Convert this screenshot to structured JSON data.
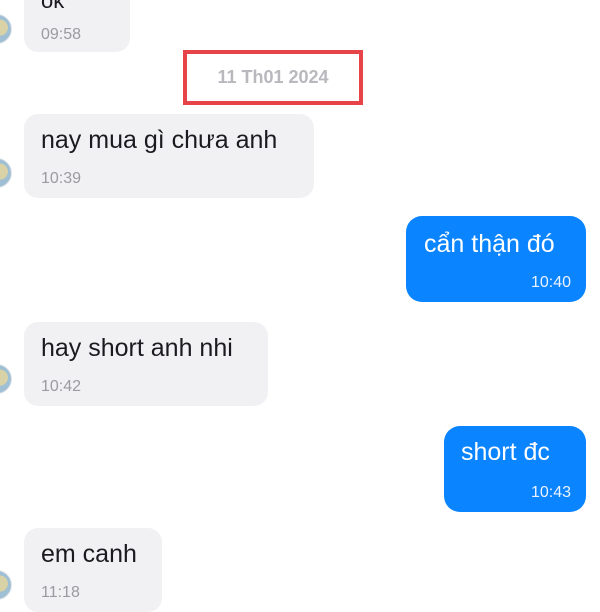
{
  "messages": [
    {
      "text": "ok",
      "time": "09:58"
    },
    {
      "text": "nay mua gì chưa anh",
      "time": "10:39"
    },
    {
      "text": "cẩn thận đó",
      "time": "10:40"
    },
    {
      "text": "hay short anh nhi",
      "time": "10:42"
    },
    {
      "text": "short đc",
      "time": "10:43"
    },
    {
      "text": "em canh",
      "time": "11:18"
    }
  ],
  "date_separator": "11 Th01 2024",
  "colors": {
    "outgoing": "#0a84ff",
    "incoming": "#f1f1f3",
    "highlight": "#e64448"
  },
  "emoji_icon": "smile-emoji-icon"
}
